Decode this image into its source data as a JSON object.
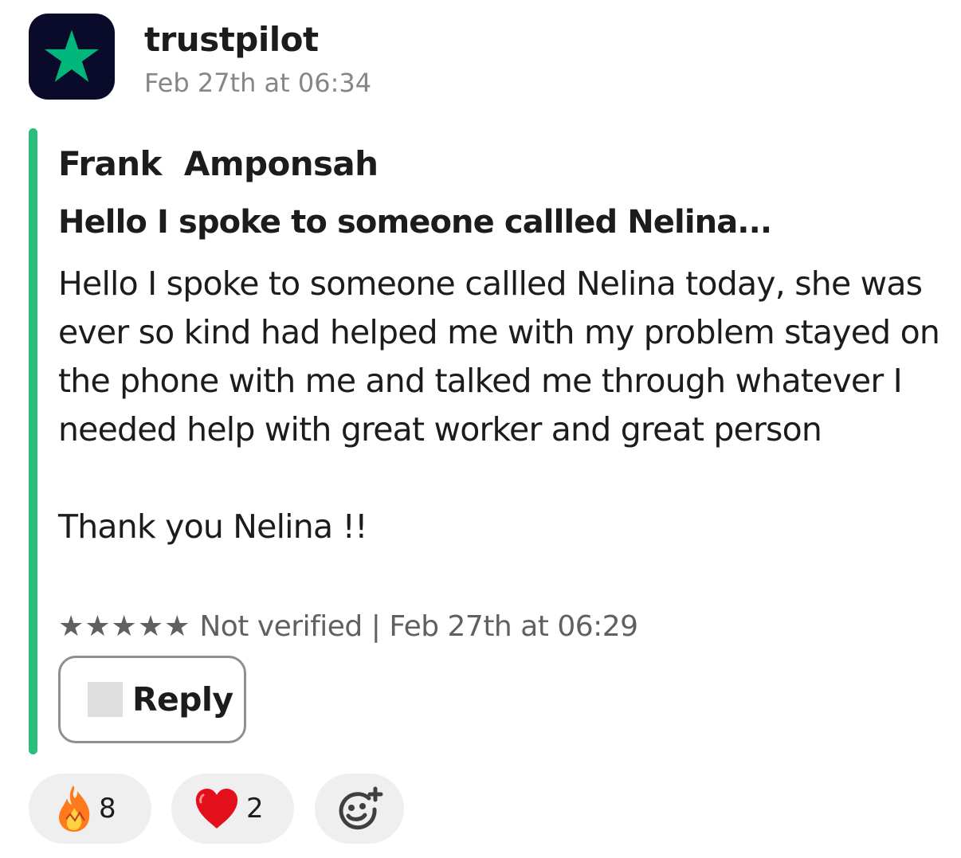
{
  "sender": {
    "name": "trustpilot",
    "timestamp": "Feb 27th at 06:34",
    "icon": "trustpilot-star-icon",
    "icon_bg": "#0a0b2a",
    "icon_star": "#00b67a"
  },
  "attachment": {
    "accent_color": "#2bbd7e",
    "author": "Frank  Amponsah",
    "title": "Hello I spoke to someone callled Nelina...",
    "body": "Hello I spoke to someone callled Nelina today, she was ever so kind had helped me with my problem stayed on the phone with me and talked me through whatever I needed help with great worker and great person\n\nThank you Nelina !!",
    "rating": {
      "stars_text": "★★★★★",
      "stars": 5,
      "out_of": 5
    },
    "verification": "Not verified",
    "separator": "|",
    "review_date": "Feb 27th at 06:29",
    "reply_button": {
      "label": "Reply",
      "icon": "reply-placeholder-icon"
    }
  },
  "reactions": [
    {
      "emoji": "fire-emoji-icon",
      "count": "8"
    },
    {
      "emoji": "heart-emoji-icon",
      "count": "2"
    },
    {
      "emoji": "add-reaction-icon"
    }
  ]
}
